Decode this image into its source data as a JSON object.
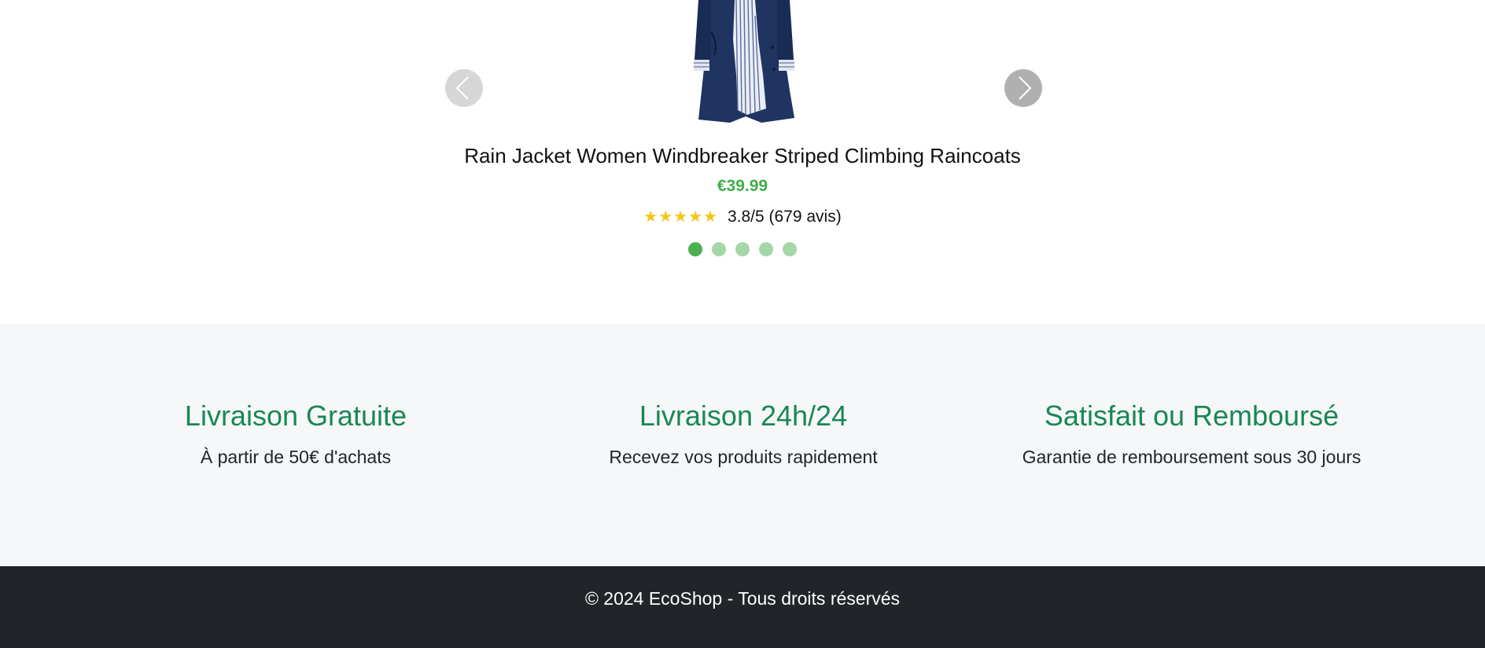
{
  "carousel": {
    "product": {
      "title": "Rain Jacket Women Windbreaker Striped Climbing Raincoats",
      "price": "€39.99",
      "stars": "★★★★★",
      "rating_text": "3.8/5 (679 avis)"
    },
    "prev_icon": "chevron-left-icon",
    "next_icon": "chevron-right-icon",
    "slide_count": 5,
    "active_slide": 1,
    "colors": {
      "price": "#3fae4a",
      "star": "#f5c518",
      "dot_active": "#4caf50",
      "dot_inactive": "#a5d6a7"
    }
  },
  "features": [
    {
      "title": "Livraison Gratuite",
      "text": "À partir de 50€ d'achats"
    },
    {
      "title": "Livraison 24h/24",
      "text": "Recevez vos produits rapidement"
    },
    {
      "title": "Satisfait ou Remboursé",
      "text": "Garantie de remboursement sous 30 jours"
    }
  ],
  "footer": {
    "text": "© 2024 EcoShop - Tous droits réservés"
  },
  "colors": {
    "feature_title": "#198754",
    "features_bg": "#f6f7f9",
    "footer_bg": "#212529"
  }
}
